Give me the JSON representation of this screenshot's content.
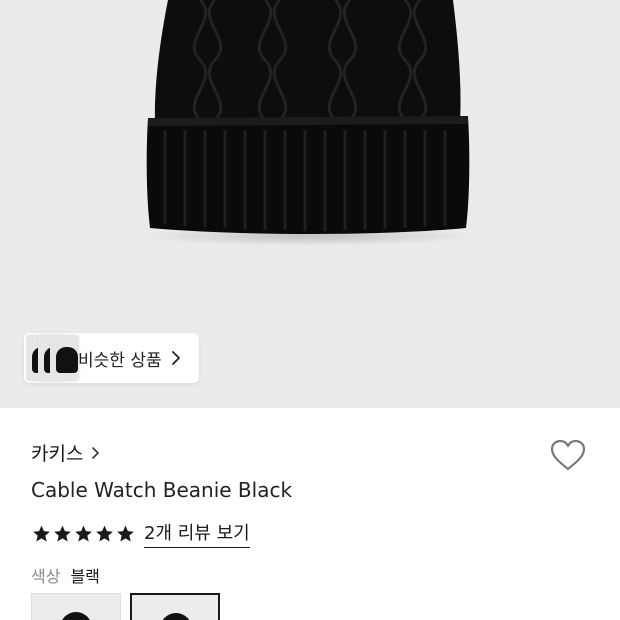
{
  "product_image": {
    "alt": "Cable Watch Beanie Black",
    "color": "#0d0d0d",
    "background": "#ebebeb"
  },
  "similar": {
    "label": "비슷한 상품"
  },
  "product": {
    "brand": "카키스",
    "name": "Cable Watch Beanie Black",
    "rating": 5,
    "rating_max": 5,
    "review_link": "2개 리뷰 보기",
    "color_label": "색상",
    "color_value": "블랙",
    "favorited": false
  },
  "swatches": [
    {
      "name": "블랙",
      "selected": false
    },
    {
      "name": "블랙",
      "selected": true
    }
  ],
  "colors": {
    "accent": "#1a1a1a",
    "muted": "#8a8a8a",
    "heart_stroke": "#7a7a7a"
  },
  "icons": {
    "chip_chevron": "chevron-right-icon",
    "brand_chevron": "chevron-right-icon",
    "heart": "heart-outline-icon",
    "star": "star-filled-icon"
  }
}
